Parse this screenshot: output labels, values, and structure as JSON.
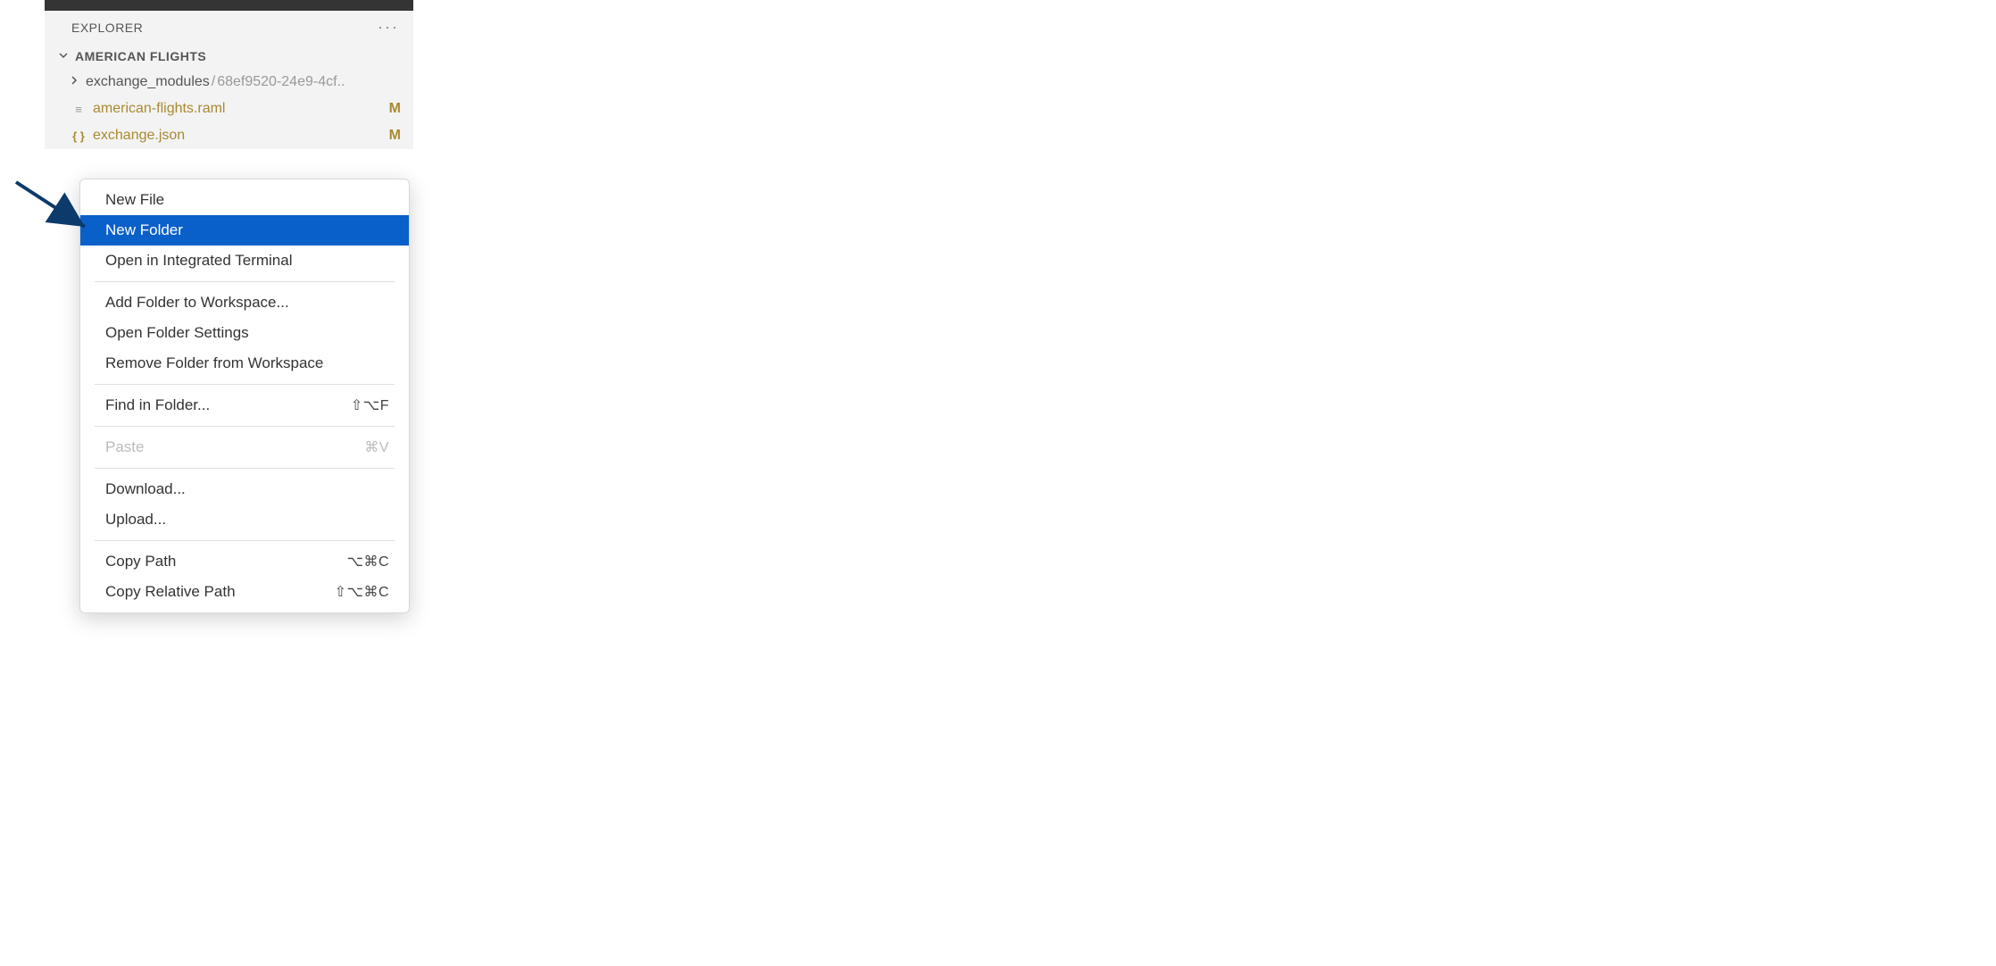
{
  "explorer": {
    "title": "EXPLORER",
    "project": "AMERICAN FLIGHTS",
    "folder": {
      "name": "exchange_modules",
      "hash": "68ef9520-24e9-4cf.."
    },
    "files": [
      {
        "icon": "lines",
        "name": "american-flights.raml",
        "status": "M"
      },
      {
        "icon": "braces",
        "name": "exchange.json",
        "status": "M"
      }
    ]
  },
  "menu": {
    "groups": [
      [
        {
          "label": "New File",
          "shortcut": "",
          "highlight": false
        },
        {
          "label": "New Folder",
          "shortcut": "",
          "highlight": true
        },
        {
          "label": "Open in Integrated Terminal",
          "shortcut": "",
          "highlight": false
        }
      ],
      [
        {
          "label": "Add Folder to Workspace...",
          "shortcut": ""
        },
        {
          "label": "Open Folder Settings",
          "shortcut": ""
        },
        {
          "label": "Remove Folder from Workspace",
          "shortcut": ""
        }
      ],
      [
        {
          "label": "Find in Folder...",
          "shortcut": "⇧⌥F"
        }
      ],
      [
        {
          "label": "Paste",
          "shortcut": "⌘V",
          "disabled": true
        }
      ],
      [
        {
          "label": "Download...",
          "shortcut": ""
        },
        {
          "label": "Upload...",
          "shortcut": ""
        }
      ],
      [
        {
          "label": "Copy Path",
          "shortcut": "⌥⌘C"
        },
        {
          "label": "Copy Relative Path",
          "shortcut": "⇧⌥⌘C"
        }
      ]
    ]
  },
  "icons": {
    "lines": "≡",
    "braces": "{ }"
  }
}
